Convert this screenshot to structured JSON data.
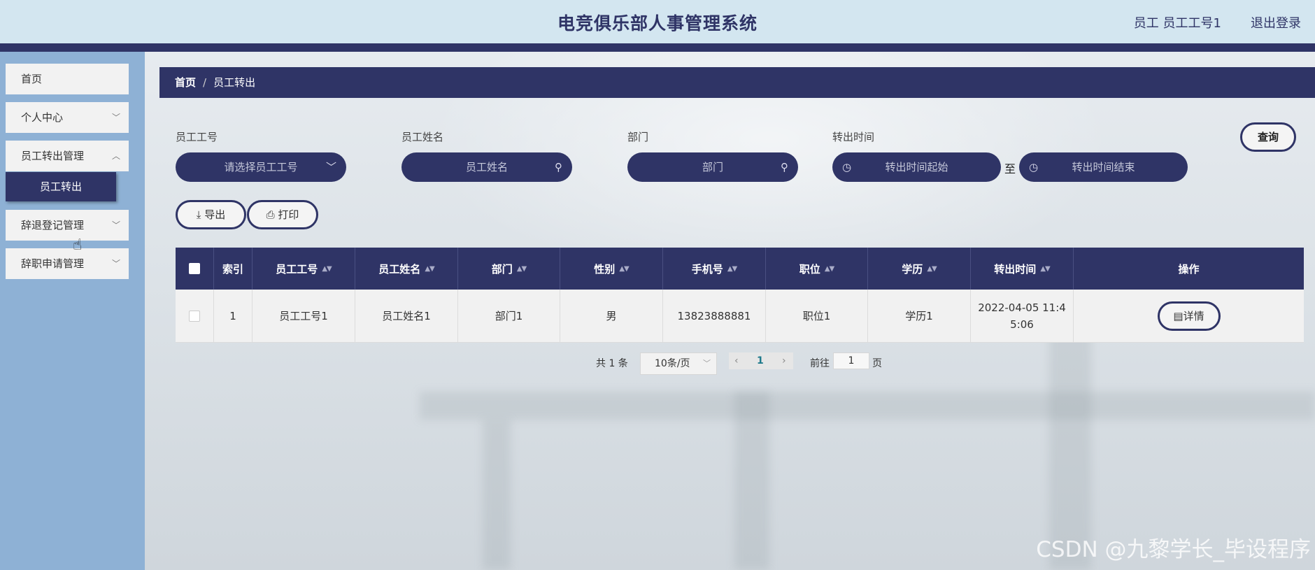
{
  "header": {
    "title": "电竞俱乐部人事管理系统",
    "user": "员工 员工工号1",
    "logout": "退出登录"
  },
  "sidebar": {
    "items": [
      {
        "label": "首页"
      },
      {
        "label": "个人中心"
      },
      {
        "label": "员工转出管理"
      },
      {
        "label": "辞退登记管理"
      },
      {
        "label": "辞职申请管理"
      }
    ],
    "active_sub": "员工转出"
  },
  "breadcrumb": {
    "home": "首页",
    "separator": "/",
    "current": "员工转出"
  },
  "filters": {
    "emp_no": {
      "label": "员工工号",
      "placeholder": "请选择员工工号"
    },
    "emp_name": {
      "label": "员工姓名",
      "placeholder": "员工姓名"
    },
    "dept": {
      "label": "部门",
      "placeholder": "部门"
    },
    "transfer_time": {
      "label": "转出时间",
      "start_placeholder": "转出时间起始",
      "end_placeholder": "转出时间结束",
      "to": "至"
    },
    "query_label": "查询",
    "export_label": "导出",
    "print_label": "打印"
  },
  "table": {
    "columns": [
      "索引",
      "员工工号",
      "员工姓名",
      "部门",
      "性别",
      "手机号",
      "职位",
      "学历",
      "转出时间",
      "操作"
    ],
    "rows": [
      {
        "index": "1",
        "emp_no": "员工工号1",
        "emp_name": "员工姓名1",
        "dept": "部门1",
        "gender": "男",
        "phone": "13823888881",
        "position": "职位1",
        "education": "学历1",
        "time_line1": "2022-04-05 11:4",
        "time_line2": "5:06",
        "action": "详情"
      }
    ]
  },
  "pagination": {
    "total": "共 1 条",
    "page_size": "10条/页",
    "current_page": "1",
    "goto_label": "前往",
    "goto_value": "1",
    "page_unit": "页"
  },
  "watermark": "CSDN @九黎学长_毕设程序",
  "colors": {
    "primary": "#2f3466",
    "sidebar": "#8eb1d5",
    "header": "#d3e6f0"
  }
}
